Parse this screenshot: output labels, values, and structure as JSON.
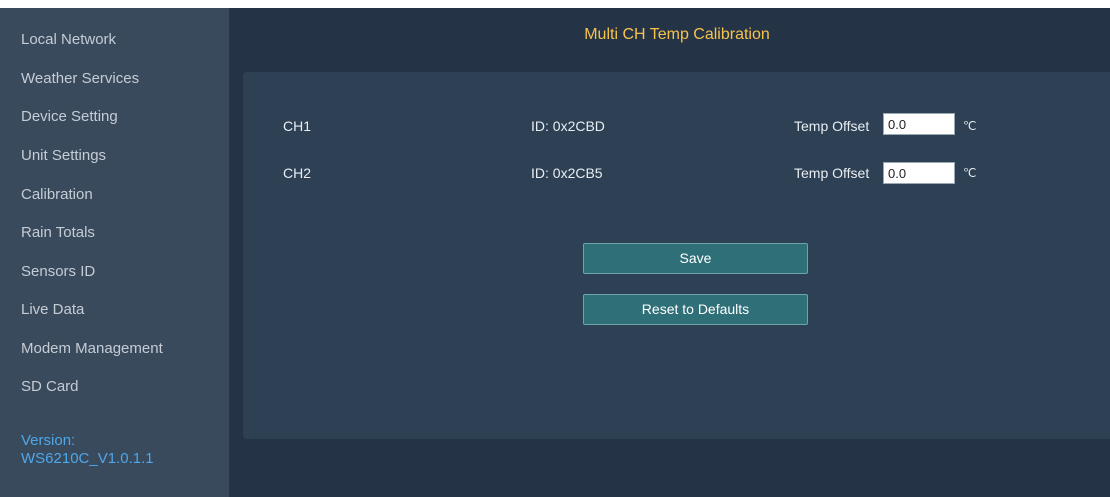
{
  "sidebar": {
    "items": [
      {
        "label": "Local Network"
      },
      {
        "label": "Weather Services"
      },
      {
        "label": "Device Setting"
      },
      {
        "label": "Unit Settings"
      },
      {
        "label": "Calibration"
      },
      {
        "label": "Rain Totals"
      },
      {
        "label": "Sensors ID"
      },
      {
        "label": "Live Data"
      },
      {
        "label": "Modem Management"
      },
      {
        "label": "SD Card"
      }
    ],
    "version_label": "Version:",
    "version_value": "WS6210C_V1.0.1.1"
  },
  "page": {
    "title": "Multi CH Temp Calibration"
  },
  "channels": [
    {
      "name": "CH1",
      "id": "ID: 0x2CBD",
      "offset_label": "Temp Offset",
      "offset_value": "0.0",
      "unit": "℃"
    },
    {
      "name": "CH2",
      "id": "ID: 0x2CB5",
      "offset_label": "Temp Offset",
      "offset_value": "0.0",
      "unit": "℃"
    }
  ],
  "buttons": {
    "save_label": "Save",
    "reset_label": "Reset to Defaults"
  },
  "colors": {
    "background": "#243446",
    "sidebar": "#3a4a5d",
    "panel": "#2e4054",
    "title": "#f6c24c",
    "version": "#4ea7e8",
    "button": "#2f6f78"
  }
}
